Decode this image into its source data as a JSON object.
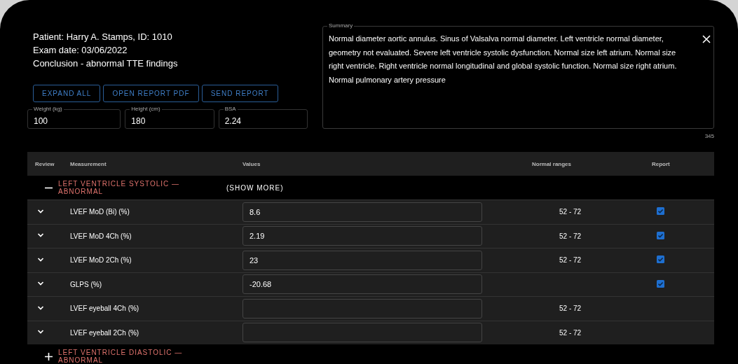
{
  "patient": {
    "lines": [
      "Patient: Harry A. Stamps, ID: 1010",
      "Exam date: 03/06/2022",
      "Conclusion - abnormal TTE findings"
    ]
  },
  "buttons": [
    "EXPAND ALL",
    "OPEN REPORT PDF",
    "SEND REPORT"
  ],
  "fields": [
    {
      "label": "Weight (kg)",
      "value": "100"
    },
    {
      "label": "Height (cm)",
      "value": "180"
    },
    {
      "label": "BSA",
      "value": "2.24"
    }
  ],
  "summary": {
    "label": "Summary",
    "value": "Normal diameter aortic annulus. Sinus of Valsalva normal diameter. Left ventricle normal diameter, geometry not evaluated. Severe left ventricle systolic dysfunction. Normal size left atrium. Normal size right ventricle. Right ventricle normal longitudinal and global systolic function. Normal size right atrium. Normal pulmonary artery pressure",
    "counter": "345"
  },
  "table": {
    "columns": [
      "Review",
      "Measurement",
      "Values",
      "Normal ranges",
      "Report"
    ],
    "groups": [
      {
        "title": "LEFT VENTRICLE SYSTOLIC — ABNORMAL",
        "expanded": true,
        "show_more": "(SHOW MORE)",
        "rows": [
          {
            "measurement": "LVEF MoD (Bi) (%)",
            "value": "8.6",
            "range": "52 - 72",
            "report": true
          },
          {
            "measurement": "LVEF MoD 4Ch (%)",
            "value": "2.19",
            "range": "52 - 72",
            "report": true
          },
          {
            "measurement": "LVEF MoD 2Ch (%)",
            "value": "23",
            "range": "52 - 72",
            "report": true
          },
          {
            "measurement": "GLPS (%)",
            "value": "-20.68",
            "report": true
          },
          {
            "measurement": "LVEF eyeball 4Ch (%)",
            "range": "52 - 72"
          },
          {
            "measurement": "LVEF eyeball 2Ch (%)",
            "range": "52 - 72"
          }
        ]
      },
      {
        "title": "LEFT VENTRICLE DIASTOLIC — ABNORMAL",
        "expanded": false
      }
    ]
  }
}
